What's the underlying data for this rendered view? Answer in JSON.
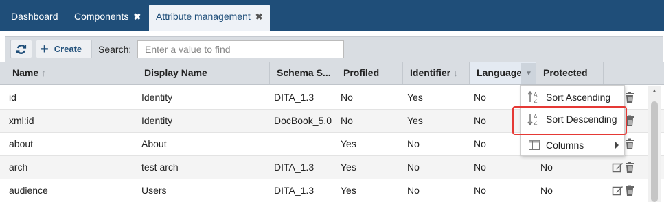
{
  "tabs": [
    {
      "label": "Dashboard",
      "closable": false,
      "active": false
    },
    {
      "label": "Components",
      "closable": true,
      "active": false
    },
    {
      "label": "Attribute management",
      "closable": true,
      "active": true
    }
  ],
  "tab_close_glyph": "✖",
  "toolbar": {
    "refresh_icon": "refresh-icon",
    "create_label": "Create",
    "search_label": "Search:",
    "search_placeholder": "Enter a value to find",
    "search_value": ""
  },
  "columns": [
    {
      "label": "Name",
      "sort": "asc"
    },
    {
      "label": "Display Name",
      "sort": ""
    },
    {
      "label": "Schema S...",
      "sort": ""
    },
    {
      "label": "Profiled",
      "sort": ""
    },
    {
      "label": "Identifier",
      "sort": "desc"
    },
    {
      "label": "Language",
      "sort": ""
    },
    {
      "label": "Protected",
      "sort": ""
    }
  ],
  "rows": [
    {
      "name": "id",
      "display": "Identity",
      "schema": "DITA_1.3",
      "profiled": "No",
      "identifier": "Yes",
      "language": "No",
      "protected": ""
    },
    {
      "name": "xml:id",
      "display": "Identity",
      "schema": "DocBook_5.0",
      "profiled": "No",
      "identifier": "Yes",
      "language": "No",
      "protected": ""
    },
    {
      "name": "about",
      "display": "About",
      "schema": "",
      "profiled": "Yes",
      "identifier": "No",
      "language": "No",
      "protected": ""
    },
    {
      "name": "arch",
      "display": "test arch",
      "schema": "DITA_1.3",
      "profiled": "Yes",
      "identifier": "No",
      "language": "No",
      "protected": "No"
    },
    {
      "name": "audience",
      "display": "Users",
      "schema": "DITA_1.3",
      "profiled": "Yes",
      "identifier": "No",
      "language": "No",
      "protected": "No"
    }
  ],
  "column_menu": {
    "items": [
      {
        "label": "Sort Ascending",
        "icon": "sort-ascending-icon"
      },
      {
        "label": "Sort Descending",
        "icon": "sort-descending-icon"
      },
      {
        "label": "Columns",
        "icon": "columns-icon",
        "submenu": true
      }
    ],
    "highlighted": "Sort Descending",
    "highlight_color": "#e53935"
  },
  "colors": {
    "tabbar": "#1f4e79",
    "toolbar": "#d9dde2",
    "accent": "#1f4e79"
  }
}
